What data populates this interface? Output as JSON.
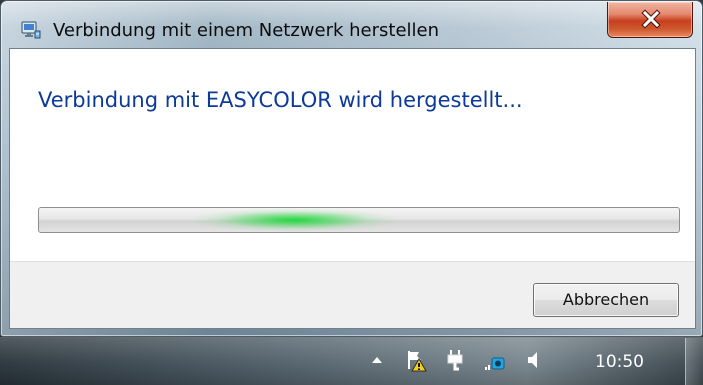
{
  "window": {
    "title": "Verbindung mit einem Netzwerk herstellen",
    "icon": "network-connection-icon",
    "close_icon": "close-icon"
  },
  "dialog": {
    "main_instruction": "Verbindung mit EASYCOLOR wird hergestellt...",
    "progress": {
      "mode": "indeterminate",
      "accent_color": "#22d84b"
    },
    "cancel_label": "Abbrechen"
  },
  "taskbar": {
    "tray_icons": [
      "show-hidden-icons-icon",
      "action-center-warning-icon",
      "power-icon",
      "network-icon",
      "volume-icon"
    ],
    "clock": "10:50"
  },
  "colors": {
    "instruction_text": "#0b3a99",
    "close_button": "#c7401f",
    "footer": "#f0f0f0"
  }
}
